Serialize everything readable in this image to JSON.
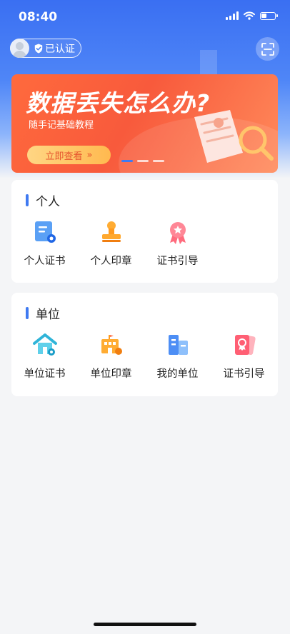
{
  "status_bar": {
    "time": "08:40"
  },
  "header": {
    "auth_label": "已认证"
  },
  "banner": {
    "title": "数据丢失怎么办?",
    "subtitle": "随手记基础教程",
    "button_label": "立即查看",
    "button_arrow": "»"
  },
  "personal": {
    "title": "个人",
    "items": [
      {
        "label": "个人证书",
        "icon": "certificate-icon"
      },
      {
        "label": "个人印章",
        "icon": "seal-icon"
      },
      {
        "label": "证书引导",
        "icon": "award-icon"
      }
    ]
  },
  "organization": {
    "title": "单位",
    "items": [
      {
        "label": "单位证书",
        "icon": "house-certificate-icon"
      },
      {
        "label": "单位印章",
        "icon": "building-seal-icon"
      },
      {
        "label": "我的单位",
        "icon": "buildings-icon"
      },
      {
        "label": "证书引导",
        "icon": "award-card-icon"
      }
    ]
  },
  "colors": {
    "accent": "#3f7af1",
    "banner": "#f85a3c",
    "background": "#f4f5f7"
  }
}
